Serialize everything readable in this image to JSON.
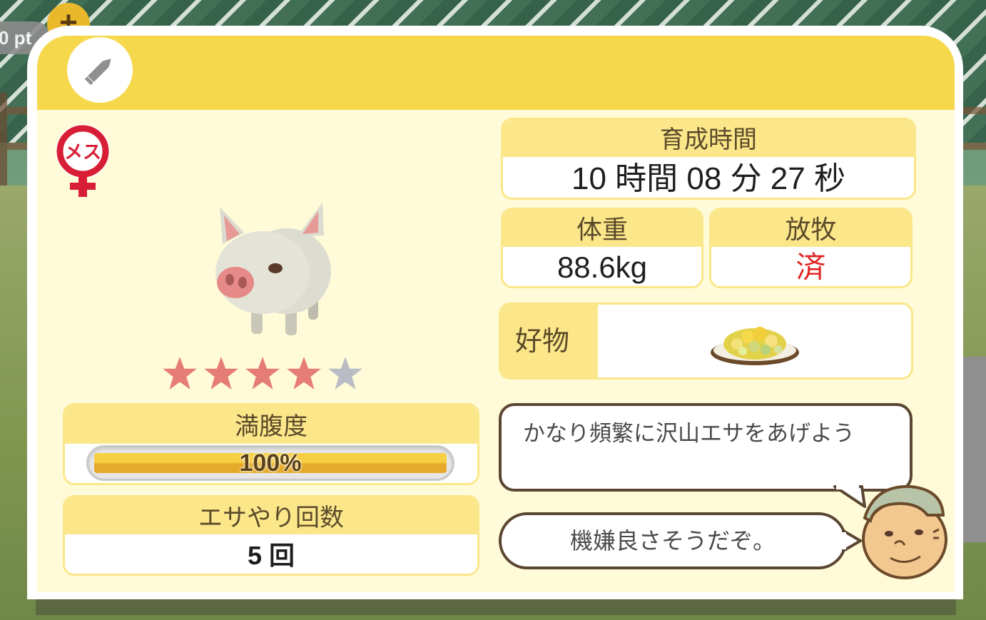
{
  "background": {
    "points_text": "0 pt",
    "plus_label": "+"
  },
  "panel": {
    "header_color": "#f6d84d",
    "gender_label": "メス",
    "gender_icon": "female-symbol-icon",
    "edit_icon": "pencil-icon",
    "rarity": {
      "filled": 4,
      "total": 5
    }
  },
  "stats": {
    "time_label": "育成時間",
    "time_value": "10 時間 08 分 27 秒",
    "weight_label": "体重",
    "weight_value": "88.6kg",
    "graze_label": "放牧",
    "graze_value": "済",
    "favorite_label": "好物",
    "favorite_icon": "corn-feed-plate-icon",
    "hunger_label": "満腹度",
    "hunger_value": "100%",
    "hunger_percent": 100,
    "feed_label": "エサやり回数",
    "feed_value": "5 回"
  },
  "farmer": {
    "advice": "かなり頻繁に沢山エサをあげよう",
    "mood": "機嫌良さそうだぞ。"
  }
}
